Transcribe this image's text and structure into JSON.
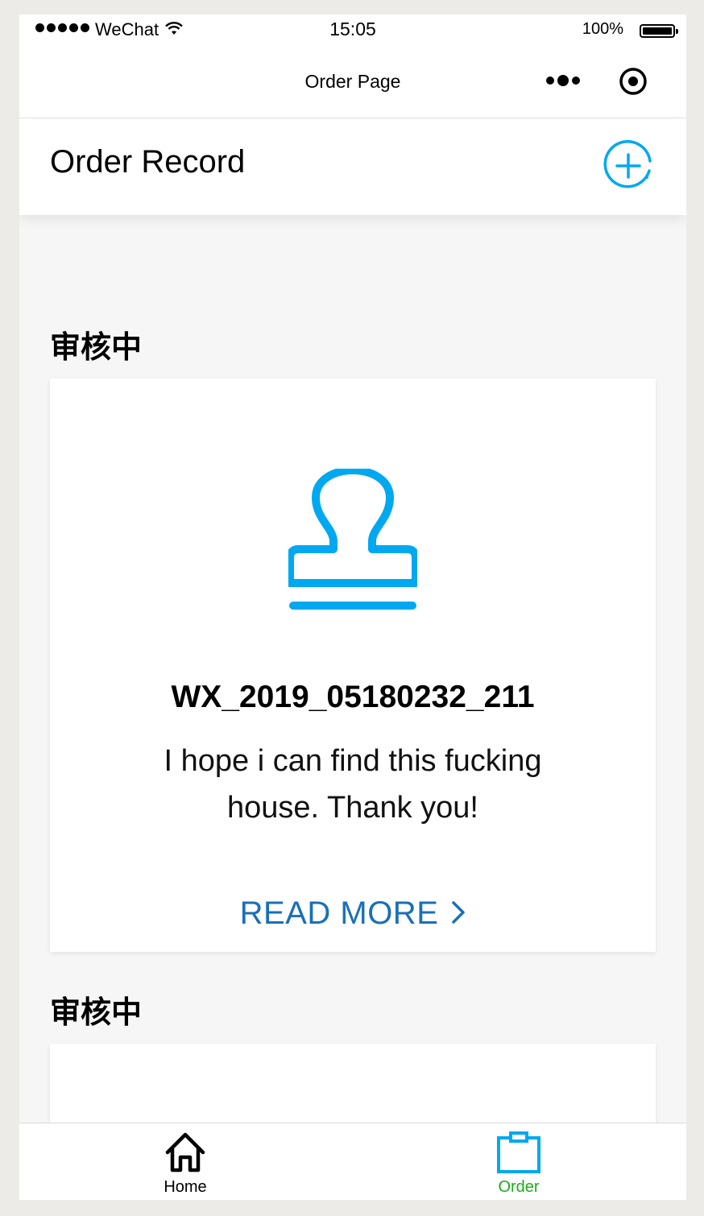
{
  "status_bar": {
    "carrier": "WeChat",
    "time": "15:05",
    "battery": "100%"
  },
  "nav_bar": {
    "title": "Order Page",
    "more_icon": "more-dots-icon",
    "close_icon": "capsule-close-icon"
  },
  "header": {
    "title": "Order Record",
    "add_icon": "add-circle-icon"
  },
  "sections": [
    {
      "title": "审核中",
      "card": {
        "icon": "stamp-icon",
        "order_id": "WX_2019_05180232_211",
        "description": "I hope i can find this fucking house. Thank you!",
        "read_more": "READ MORE"
      }
    },
    {
      "title": "审核中"
    }
  ],
  "tab_bar": {
    "tabs": [
      {
        "label": "Home",
        "icon": "home-icon",
        "active": false
      },
      {
        "label": "Order",
        "icon": "clipboard-icon",
        "active": true
      }
    ]
  },
  "colors": {
    "accent_blue": "#00a8f0",
    "link_blue": "#1a6fb8",
    "active_green": "#1aad19",
    "page_background": "#f6f6f6"
  }
}
